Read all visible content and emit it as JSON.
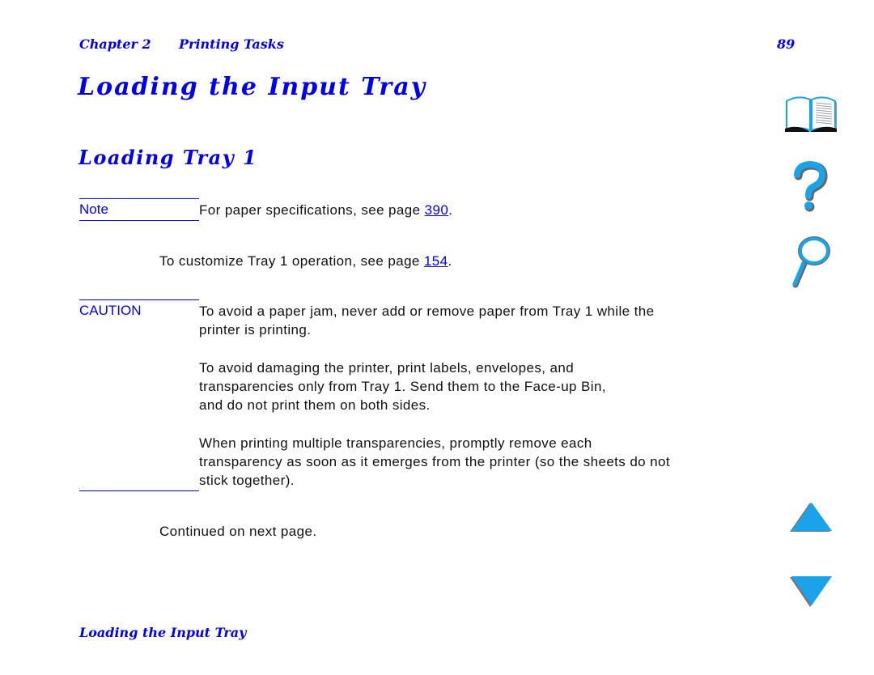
{
  "header": {
    "chapter": "Chapter 2",
    "section": "Printing Tasks",
    "page_number": "89"
  },
  "title": "Loading the Input Tray",
  "subtitle": "Loading Tray 1",
  "note": {
    "label": "Note",
    "text_before": "For paper specifications, see page ",
    "link": "390",
    "text_after": "."
  },
  "customize": {
    "text_before": "To customize Tray 1 operation, see page ",
    "link": "154",
    "text_after": "."
  },
  "caution": {
    "label": "CAUTION",
    "paragraphs": [
      [
        "To avoid a paper jam, never add or remove paper from Tray 1 while the",
        "printer is printing."
      ],
      [
        "To avoid damaging the printer, print labels, envelopes, and",
        "transparencies only from Tray 1. Send them to the Face-up Bin,",
        "and do not print them on both sides."
      ],
      [
        "When printing multiple transparencies, promptly remove each",
        "transparency as soon as it emerges from the printer (so the sheets do not",
        "stick together)."
      ]
    ]
  },
  "continued": "Continued on next page.",
  "footer": "Loading the Input Tray",
  "nav": {
    "icons": [
      "book-icon",
      "help-question-icon",
      "search-magnifier-icon",
      "previous-page-arrow-icon",
      "next-page-arrow-icon"
    ]
  },
  "colors": {
    "accent": "#0000ee",
    "icon_fill": "#1aa3e8"
  }
}
